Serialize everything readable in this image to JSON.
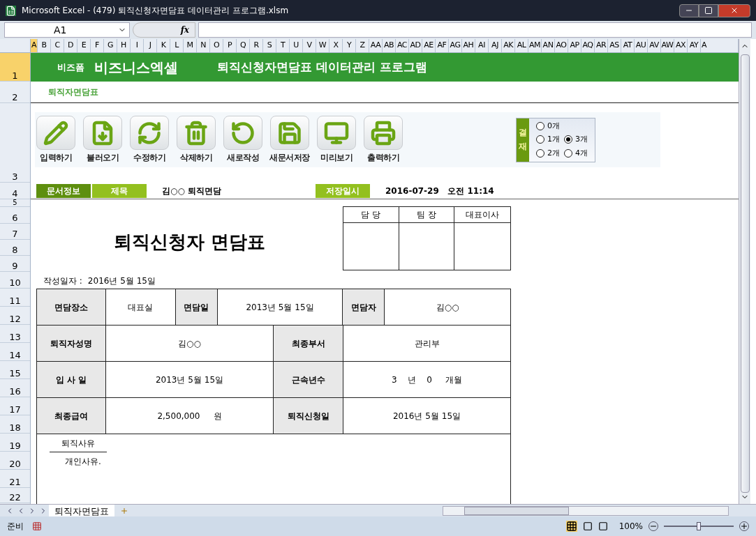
{
  "window": {
    "title": "Microsoft Excel - (479) 퇴직신청자면담표 데이터관리 프로그램.xlsm"
  },
  "formula_bar": {
    "name_box": "A1",
    "fx": "fx"
  },
  "columns": [
    "A",
    "B",
    "C",
    "D",
    "E",
    "F",
    "G",
    "H",
    "I",
    "J",
    "K",
    "L",
    "M",
    "N",
    "O",
    "P",
    "Q",
    "R",
    "S",
    "T",
    "U",
    "V",
    "W",
    "X",
    "Y",
    "Z",
    "AA",
    "AB",
    "AC",
    "AD",
    "AE",
    "AF",
    "AG",
    "AH",
    "AI",
    "AJ",
    "AK",
    "AL",
    "AM",
    "AN",
    "AO",
    "AP",
    "AQ",
    "AR",
    "AS",
    "AT",
    "AU",
    "AV",
    "AW",
    "AX",
    "AY",
    "A"
  ],
  "rows": [
    "1",
    "2",
    "3",
    "4",
    "5",
    "6",
    "7",
    "8",
    "9",
    "10",
    "11",
    "12",
    "13",
    "14",
    "15",
    "16",
    "17",
    "18",
    "19",
    "20",
    "21",
    "22"
  ],
  "banner": {
    "brand_small": "비즈폼",
    "brand": "비즈니스엑셀",
    "title": "퇴직신청자면담표 데이터관리 프로그램"
  },
  "subtitle": "퇴직자면담표",
  "toolbar": [
    {
      "label": "입력하기"
    },
    {
      "label": "불러오기"
    },
    {
      "label": "수정하기"
    },
    {
      "label": "삭제하기"
    },
    {
      "label": "새로작성"
    },
    {
      "label": "새문서저장"
    },
    {
      "label": "미리보기"
    },
    {
      "label": "출력하기"
    }
  ],
  "approval_count": {
    "label": "결재",
    "options": [
      {
        "label": "0개",
        "selected": false
      },
      {
        "label": "1개",
        "selected": false
      },
      {
        "label": "2개",
        "selected": false
      },
      {
        "label": "3개",
        "selected": true
      },
      {
        "label": "4개",
        "selected": false
      }
    ]
  },
  "doc_info": {
    "section": "문서정보",
    "title_label": "제목",
    "title_value": "김○○ 퇴직면담",
    "saved_label": "저장일시",
    "saved_value": "2016-07-29   오전 11:14"
  },
  "form": {
    "title": "퇴직신청자 면담표",
    "approval_headers": [
      "담 당",
      "팀 장",
      "대표이사"
    ],
    "written_label": "작성일자 :",
    "written_date": "2016년 5월 15일",
    "row_1": [
      {
        "label": "면담장소",
        "value": "대표실"
      },
      {
        "label": "면담일",
        "value": "2013년 5월 15일"
      },
      {
        "label": "면담자",
        "value": "김○○"
      }
    ],
    "rows": [
      [
        {
          "label": "퇴직자성명",
          "value": "김○○"
        },
        {
          "label": "최종부서",
          "value": "관리부"
        }
      ],
      [
        {
          "label": "입 사 일",
          "value": "2013년 5월 15일"
        },
        {
          "label": "근속년수",
          "value": "3    년    0     개월"
        }
      ],
      [
        {
          "label": "최종급여",
          "value": "2,500,000     원"
        },
        {
          "label": "퇴직신청일",
          "value": "2016년 5월 15일"
        }
      ]
    ],
    "reason_label": "퇴직사유",
    "reason_value": "개인사유."
  },
  "sheet_tabs": [
    {
      "label": "퇴직자면담표",
      "selected": true
    }
  ],
  "status_bar": {
    "status": "준비",
    "zoom": "100%",
    "zoom_slider": {
      "level": 0.5
    }
  }
}
